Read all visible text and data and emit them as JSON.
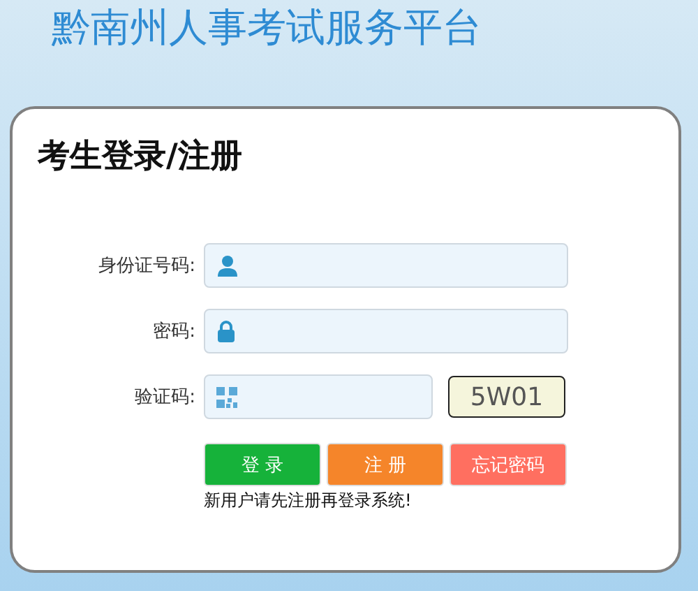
{
  "site_title": "黔南州人事考试服务平台",
  "card": {
    "title": "考生登录/注册",
    "fields": [
      {
        "label": "身份证号码:",
        "kind": "user"
      },
      {
        "label": "密码:",
        "kind": "password"
      },
      {
        "label": "验证码:",
        "kind": "captcha",
        "captcha": "5W01"
      }
    ],
    "buttons": [
      {
        "label": "登 录",
        "kind": "login"
      },
      {
        "label": "注 册",
        "kind": "register"
      },
      {
        "label": "忘记密码",
        "kind": "forgot"
      }
    ],
    "note": "新用户请先注册再登录系统!"
  }
}
